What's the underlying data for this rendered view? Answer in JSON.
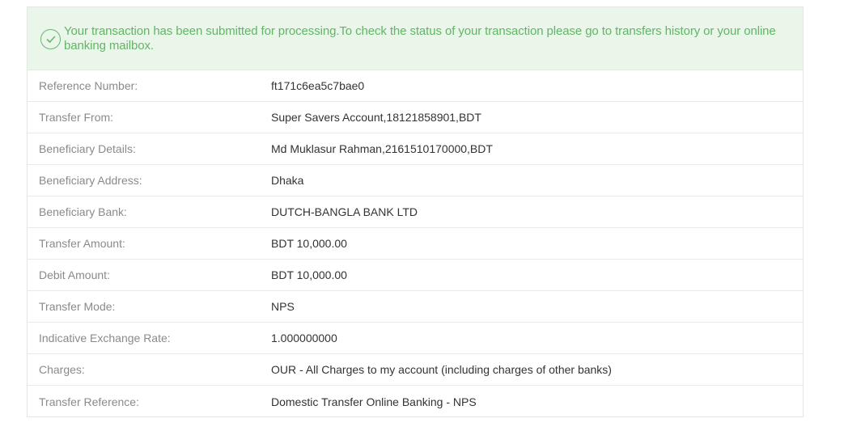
{
  "alert": {
    "icon": "check-circle-icon",
    "message": "Your transaction has been submitted for processing.To check the status of your transaction please go to transfers history or your online banking mailbox.",
    "color": "#62b566",
    "background": "#e9f6e9"
  },
  "details": [
    {
      "label": "Reference Number:",
      "value": "ft171c6ea5c7bae0"
    },
    {
      "label": "Transfer From:",
      "value": "Super Savers Account,18121858901,BDT"
    },
    {
      "label": "Beneficiary Details:",
      "value": "Md Muklasur Rahman,2161510170000,BDT"
    },
    {
      "label": "Beneficiary Address:",
      "value": "Dhaka"
    },
    {
      "label": "Beneficiary Bank:",
      "value": "DUTCH-BANGLA BANK LTD"
    },
    {
      "label": "Transfer Amount:",
      "value": "BDT 10,000.00"
    },
    {
      "label": "Debit Amount:",
      "value": "BDT 10,000.00"
    },
    {
      "label": "Transfer Mode:",
      "value": "NPS"
    },
    {
      "label": "Indicative Exchange Rate:",
      "value": "1.000000000"
    },
    {
      "label": "Charges:",
      "value": "OUR - All Charges to my account (including charges of other banks)"
    },
    {
      "label": "Transfer Reference:",
      "value": "Domestic Transfer Online Banking - NPS"
    }
  ]
}
